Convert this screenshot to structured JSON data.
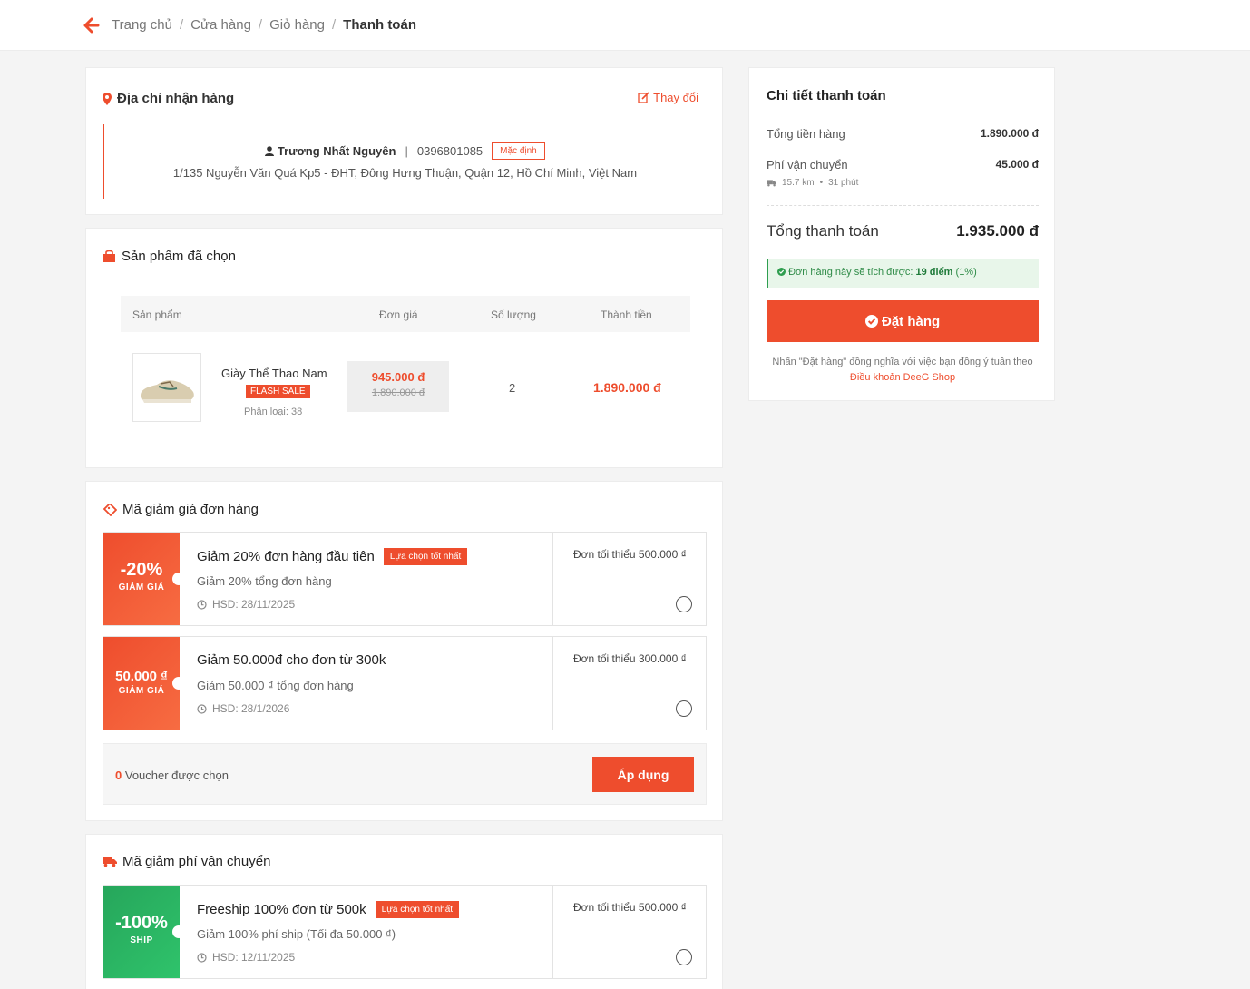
{
  "breadcrumb": {
    "items": [
      "Trang chủ",
      "Cửa hàng",
      "Giỏ hàng"
    ],
    "current": "Thanh toán"
  },
  "address": {
    "title": "Địa chỉ nhận hàng",
    "change_label": "Thay đổi",
    "name": "Trương Nhất Nguyên",
    "phone": "0396801085",
    "default_badge": "Mặc định",
    "full_address": "1/135 Nguyễn Văn Quá Kp5 - ĐHT, Đông Hưng Thuận, Quận 12, Hồ Chí Minh, Việt Nam"
  },
  "products": {
    "title": "Sản phẩm đã chọn",
    "headers": [
      "Sản phẩm",
      "Đơn giá",
      "Số lượng",
      "Thành tiền"
    ],
    "items": [
      {
        "name": "Giày Thể Thao Nam",
        "tag": "FLASH SALE",
        "variant": "Phân loại: 38",
        "price": "945.000 đ",
        "old_price": "1.890.000 đ",
        "qty": "2",
        "total": "1.890.000 đ"
      }
    ]
  },
  "order_vouchers": {
    "title": "Mã giảm giá đơn hàng",
    "items": [
      {
        "big": "-20%",
        "label": "GIẢM GIÁ",
        "title": "Giảm 20% đơn hàng đầu tiên",
        "best": "Lựa chọn tốt nhất",
        "desc": "Giảm 20% tổng đơn hàng",
        "expiry": "HSD: 28/11/2025",
        "min": "Đơn tối thiểu 500.000 ₫"
      },
      {
        "big": "50.000 ₫",
        "label": "GIẢM GIÁ",
        "title": "Giảm 50.000đ cho đơn từ 300k",
        "desc": "Giảm 50.000 ₫ tổng đơn hàng",
        "expiry": "HSD: 28/1/2026",
        "min": "Đơn tối thiểu 300.000 ₫"
      }
    ],
    "selected_count": "0",
    "selected_text": "Voucher được chọn",
    "apply_label": "Áp dụng"
  },
  "shipping_vouchers": {
    "title": "Mã giảm phí vận chuyển",
    "items": [
      {
        "big": "-100%",
        "label": "SHIP",
        "title": "Freeship 100% đơn từ 500k",
        "best": "Lựa chọn tốt nhất",
        "desc": "Giảm 100% phí ship (Tối đa 50.000 ₫)",
        "expiry": "HSD: 12/11/2025",
        "min": "Đơn tối thiểu 500.000 ₫"
      }
    ]
  },
  "summary": {
    "title": "Chi tiết thanh toán",
    "subtotal_label": "Tổng tiền hàng",
    "subtotal": "1.890.000 đ",
    "shipping_label": "Phí vận chuyển",
    "shipping": "45.000 đ",
    "distance": "15.7 km",
    "duration": "31 phút",
    "total_label": "Tổng thanh toán",
    "total": "1.935.000 đ",
    "points_prefix": "Đơn hàng này sẽ tích được:",
    "points_value": "19 điểm",
    "points_pct": "(1%)",
    "order_button": "Đặt hàng",
    "terms_text": "Nhấn \"Đặt hàng\" đồng nghĩa với việc bạn đồng ý tuân theo",
    "terms_link": "Điều khoản DeeG Shop"
  },
  "colors": {
    "accent": "#ee4d2d",
    "success": "#2e9e4f",
    "background": "#f4f4f4"
  }
}
